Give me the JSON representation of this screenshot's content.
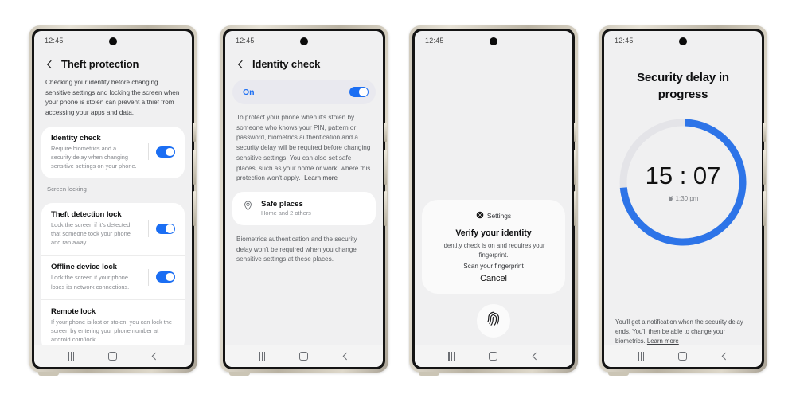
{
  "meta": {
    "accent_blue": "#1b6ef3",
    "screen_bg": "#f0f0f1",
    "card_bg": "#ffffff",
    "frame_gold": "#cfc9bb"
  },
  "phones": [
    {
      "id": "theft-protection",
      "status_time": "12:45",
      "title": "Theft protection",
      "description": "Checking your identity before changing sensitive settings and locking the screen when your phone is stolen can prevent a thief from accessing your apps and data.",
      "rows": [
        {
          "title": "Identity check",
          "subtitle": "Require biometrics and a security delay when changing sensitive settings on your phone.",
          "toggle": "on"
        }
      ],
      "section_label": "Screen locking",
      "lock_rows": [
        {
          "title": "Theft detection lock",
          "subtitle": "Lock the screen if it's detected that someone took your phone and ran away.",
          "toggle": "on"
        },
        {
          "title": "Offline device lock",
          "subtitle": "Lock the screen if your phone loses its network connections.",
          "toggle": "on"
        },
        {
          "title": "Remote lock",
          "subtitle": "If your phone is lost or stolen, you can lock the screen by entering your phone number at android.com/lock.",
          "toggle": "none"
        }
      ]
    },
    {
      "id": "identity-check",
      "status_time": "12:45",
      "title": "Identity check",
      "on_label": "On",
      "toggle": "on",
      "description": "To protect your phone when it's stolen by someone who knows your PIN, pattern or password, biometrics authentication and a security delay will be required before changing sensitive settings. You can also set safe places, such as your home or work, where this protection won't apply.",
      "learn_more": "Learn more",
      "safe_places": {
        "title": "Safe places",
        "subtitle": "Home and 2 others",
        "icon": "location-pin-icon"
      },
      "footer_note": "Biometrics authentication and the security delay won't be required when you change sensitive settings at these places."
    },
    {
      "id": "verify-identity",
      "status_time": "12:45",
      "dialog": {
        "app_icon": "gear-icon",
        "app_name": "Settings",
        "title": "Verify your identity",
        "description": "Identity check is on and requires your fingerprint.",
        "hint": "Scan your fingerprint",
        "cancel_label": "Cancel"
      },
      "fingerprint_icon": "fingerprint-icon"
    },
    {
      "id": "security-delay",
      "status_time": "12:45",
      "title": "Security delay in progress",
      "timer": "15 : 07",
      "end_time": "1:30 pm",
      "alarm_icon": "alarm-icon",
      "progress_percent": 73,
      "ring_track_color": "#e4e4e8",
      "ring_fill_color": "#2d74e8",
      "note": "You'll get a notification when the security delay ends. You'll then be able to change your biometrics.",
      "learn_more": "Learn more"
    }
  ],
  "navbar": {
    "recents": "recents-icon",
    "home": "home-icon",
    "back": "back-icon"
  }
}
